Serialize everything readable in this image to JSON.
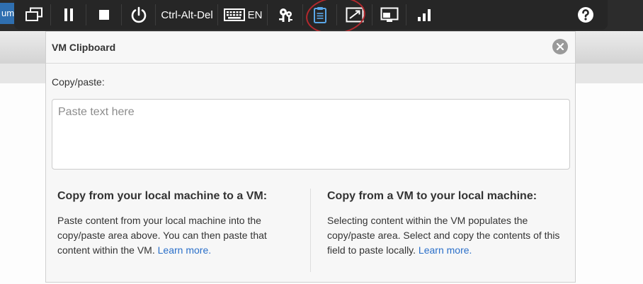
{
  "background": {
    "tab_text": "um"
  },
  "toolbar": {
    "ctrl_alt_del_label": "Ctrl-Alt-Del",
    "keyboard_lang": "EN",
    "icons": [
      "multi-monitor-icon",
      "pause-icon",
      "stop-icon",
      "power-icon",
      "keyboard-icon",
      "keys-icon",
      "clipboard-icon",
      "fullscreen-icon",
      "screen-icon",
      "signal-icon",
      "help-icon"
    ],
    "highlight_color": "#b3282d"
  },
  "dialog": {
    "title": "VM Clipboard",
    "copy_paste_label": "Copy/paste:",
    "textarea_placeholder": "Paste text here",
    "left": {
      "heading": "Copy from your local machine to a VM:",
      "body": "Paste content from your local machine into the copy/paste area above. You can then paste that content within the VM.",
      "link": "Learn more."
    },
    "right": {
      "heading": "Copy from a VM to your local machine:",
      "body": "Selecting content within the VM populates the copy/paste area. Select and copy the contents of this field to paste locally.",
      "link": "Learn more."
    }
  },
  "colors": {
    "toolbar_bg": "#262626",
    "link": "#2a6fc9",
    "clipboard_icon": "#5aa7e8"
  }
}
